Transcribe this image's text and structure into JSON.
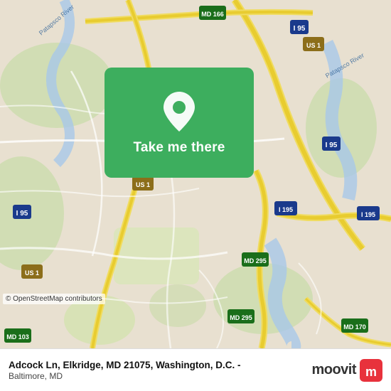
{
  "map": {
    "alt": "Map showing Adcock Ln, Elkridge, MD 21075 area near Washington D.C. and Baltimore"
  },
  "card": {
    "label": "Take me there"
  },
  "info_bar": {
    "address_line1": "Adcock Ln, Elkridge, MD 21075, Washington, D.C. -",
    "address_line2": "Baltimore, MD",
    "osm_credit": "© OpenStreetMap contributors",
    "moovit_text": "moovit"
  },
  "icons": {
    "location_pin": "location-pin-icon",
    "moovit_logo": "moovit-logo-icon"
  },
  "colors": {
    "card_green": "#3dae5e",
    "road_yellow": "#f5e642",
    "highway_shield": "#3a7bd5"
  }
}
